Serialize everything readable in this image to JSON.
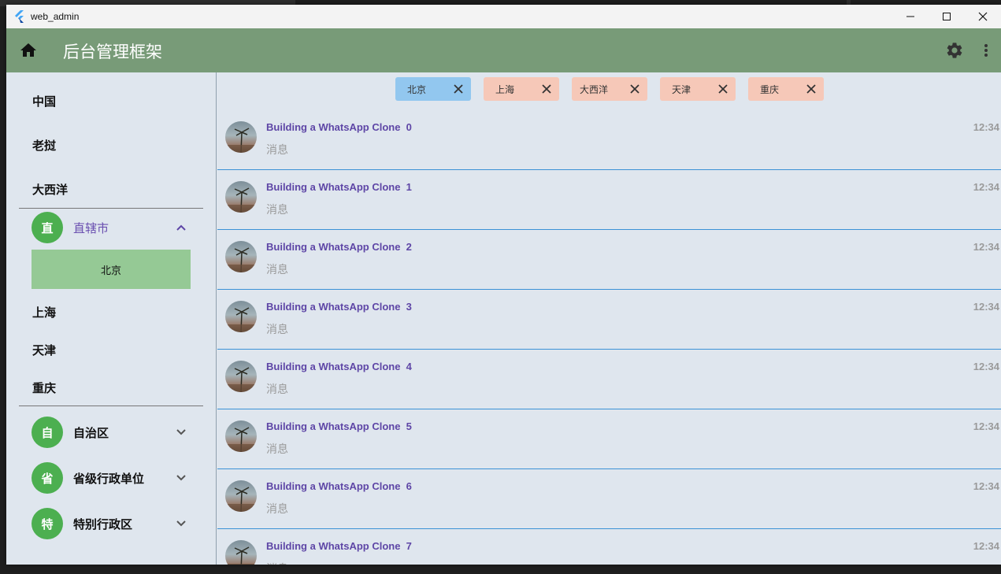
{
  "window": {
    "title": "web_admin"
  },
  "appbar": {
    "title": "后台管理框架"
  },
  "sidebar": {
    "top_items": [
      {
        "label": "中国"
      },
      {
        "label": "老挝"
      },
      {
        "label": "大西洋"
      }
    ],
    "groups": [
      {
        "avatar": "直",
        "label": "直辖市",
        "expanded": true,
        "children": [
          {
            "label": "北京",
            "selected": true
          },
          {
            "label": "上海"
          },
          {
            "label": "天津"
          },
          {
            "label": "重庆"
          }
        ]
      },
      {
        "avatar": "自",
        "label": "自治区",
        "expanded": false
      },
      {
        "avatar": "省",
        "label": "省级行政单位",
        "expanded": false
      },
      {
        "avatar": "特",
        "label": "特别行政区",
        "expanded": false
      }
    ]
  },
  "tabs": [
    {
      "label": "北京",
      "selected": true
    },
    {
      "label": "上海",
      "selected": false
    },
    {
      "label": "大西洋",
      "selected": false
    },
    {
      "label": "天津",
      "selected": false
    },
    {
      "label": "重庆",
      "selected": false
    }
  ],
  "messages": [
    {
      "title": "Building a WhatsApp Clone  0",
      "subtitle": "消息",
      "time": "12:34"
    },
    {
      "title": "Building a WhatsApp Clone  1",
      "subtitle": "消息",
      "time": "12:34"
    },
    {
      "title": "Building a WhatsApp Clone  2",
      "subtitle": "消息",
      "time": "12:34"
    },
    {
      "title": "Building a WhatsApp Clone  3",
      "subtitle": "消息",
      "time": "12:34"
    },
    {
      "title": "Building a WhatsApp Clone  4",
      "subtitle": "消息",
      "time": "12:34"
    },
    {
      "title": "Building a WhatsApp Clone  5",
      "subtitle": "消息",
      "time": "12:34"
    },
    {
      "title": "Building a WhatsApp Clone  6",
      "subtitle": "消息",
      "time": "12:34"
    },
    {
      "title": "Building a WhatsApp Clone  7",
      "subtitle": "消息",
      "time": "12:34"
    }
  ],
  "colors": {
    "appbar": "#789b78",
    "accent": "#6a4fb0",
    "group_avatar": "#4caf50",
    "selected_sub": "#95c995",
    "tab_selected": "#92c7ef",
    "tab": "#f6c8b8",
    "row_divider": "#3b92d6"
  },
  "icons": {
    "home": "home-icon",
    "settings": "gear-icon",
    "more": "more-vert-icon",
    "chevron_up": "chevron-up-icon",
    "chevron_down": "chevron-down-icon",
    "close": "close-icon"
  }
}
